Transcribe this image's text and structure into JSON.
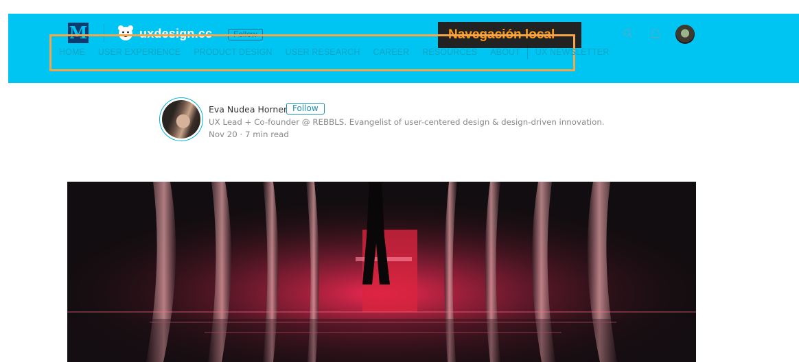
{
  "header": {
    "logo_letter": "M",
    "publication_name": "uxdesign.cc",
    "follow_label": "Follow",
    "annotation_label": "Navegación local",
    "icons": [
      "search-icon",
      "bell-icon"
    ],
    "brand_color": "#00c4f2",
    "annotation_color": "#ff9a17"
  },
  "nav": {
    "items": [
      "HOME",
      "USER EXPERIENCE",
      "PRODUCT DESIGN",
      "USER RESEARCH",
      "CAREER",
      "RESOURCES",
      "ABOUT"
    ],
    "newsletter_label": "UX NEWSLETTER"
  },
  "author": {
    "name": "Eva Nudea Horner",
    "follow_label": "Follow",
    "bio": "UX Lead + Co-founder @ REBBLS. Evangelist of user-centered design & design-driven innovation.",
    "meta": "Nov 20 · 7 min read"
  }
}
